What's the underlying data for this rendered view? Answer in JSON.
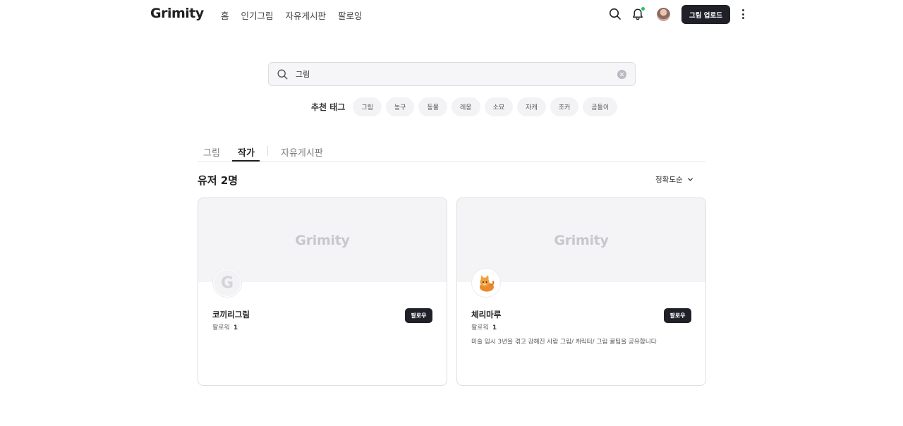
{
  "header": {
    "logo": "Grimity",
    "nav": [
      "홈",
      "인기그림",
      "자유게시판",
      "팔로잉"
    ],
    "upload_label": "그림 업로드",
    "icons": [
      "search-icon",
      "bell-icon",
      "more-icon"
    ],
    "notification_dot_color": "#22c55e"
  },
  "search": {
    "value": "그림"
  },
  "tags": {
    "title": "추천 태그",
    "items": [
      "그림",
      "농구",
      "동물",
      "레옹",
      "소묘",
      "자캐",
      "조커",
      "곰돌이"
    ]
  },
  "tabs": {
    "items": [
      "그림",
      "작가",
      "자유게시판"
    ],
    "active": "작가"
  },
  "results": {
    "title": "유저 2명",
    "sort_label": "정확도순"
  },
  "users": [
    {
      "banner_text": "Grimity",
      "avatar_letter": "G",
      "name": "코끼리그림",
      "followers_label": "팔로워",
      "followers": "1",
      "description": "",
      "follow_label": "팔로우"
    },
    {
      "banner_text": "Grimity",
      "avatar_letter": "",
      "name": "체리마루",
      "followers_label": "팔로워",
      "followers": "1",
      "description": "미술 입시 3년을 겪고 강해진 사람 그림/ 캐릭터/ 그림 꿀팁을 공유합니다",
      "follow_label": "팔로우"
    }
  ],
  "colors": {
    "primary_button": "#1f2028",
    "banner_bg": "#f4f4f7"
  }
}
